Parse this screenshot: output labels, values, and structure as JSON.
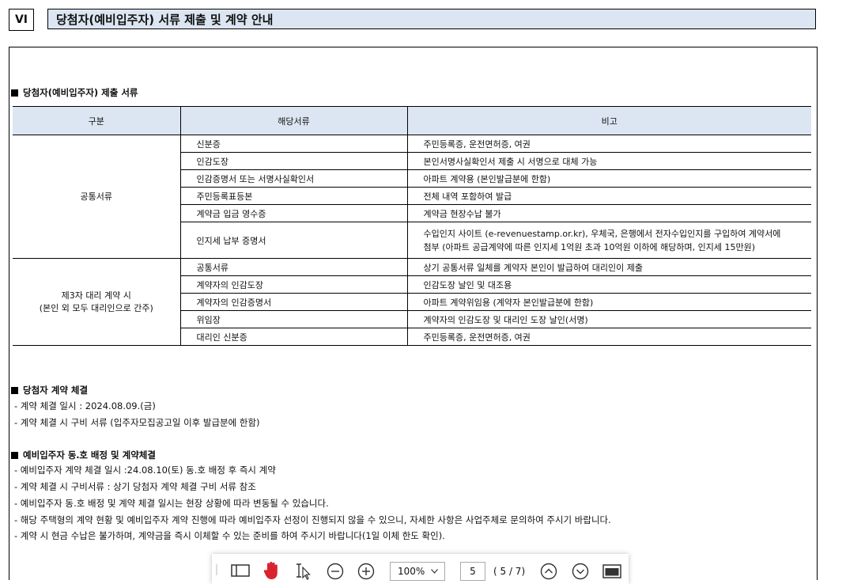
{
  "section": {
    "number": "VI",
    "title": "당첨자(예비입주자) 서류 제출 및 계약 안내"
  },
  "docs_section": {
    "heading": "당첨자(예비입주자) 제출 서류",
    "columns": [
      "구분",
      "해당서류",
      "비고"
    ],
    "groups": [
      {
        "category": "공통서류",
        "rows": [
          {
            "doc": "신분증",
            "note": "주민등록증, 운전면허증, 여권"
          },
          {
            "doc": "인감도장",
            "note": "본인서명사실확인서 제출 시 서명으로 대체 가능"
          },
          {
            "doc": "인감증명서 또는 서명사실확인서",
            "note": "아파트 계약용 (본인발급분에 한함)"
          },
          {
            "doc": "주민등록표등본",
            "note": "전체 내역 포함하여 발급"
          },
          {
            "doc": "계약금 입금 영수증",
            "note": "계약금 현장수납 불가"
          },
          {
            "doc": "인지세 납부 증명서",
            "note_line1": "수입인지 사이트 (e-revenuestamp.or.kr), 우체국, 은행에서 전자수입인지를 구입하여 계약서에",
            "note_line2": "첨부 (아파트 공급계약에 따른 인지세 1억원 초과 10억원 이하에 해당하며, 인지세 15만원)"
          }
        ]
      },
      {
        "category_line1": "제3자 대리 계약 시",
        "category_line2": "(본인 외 모두 대리인으로 간주)",
        "rows": [
          {
            "doc": "공통서류",
            "note": "상기 공통서류 일체를 계약자 본인이 발급하여 대리인이 제출"
          },
          {
            "doc": "계약자의 인감도장",
            "note": "인감도장 날인 및 대조용"
          },
          {
            "doc": "계약자의 인감증명서",
            "note": "아파트 계약위임용 (계약자 본인발급분에 한함)"
          },
          {
            "doc": "위임장",
            "note": "계약자의 인감도장 및 대리인 도장 날인(서명)"
          },
          {
            "doc": "대리인 신분증",
            "note": "주민등록증, 운전면허증, 여권"
          }
        ]
      }
    ]
  },
  "contract_section": {
    "heading": "당첨자 계약 체결",
    "lines": [
      "- 계약 체결 일시 : 2024.08.09.(금)",
      "- 계약 체결 시 구비 서류 (입주자모집공고일 이후 발급분에 한함)"
    ]
  },
  "reserve_section": {
    "heading": "예비입주자 동․호 배정 및 계약체결",
    "lines": [
      "- 예비입주자 계약 체결 일시 :24.08.10(토) 동․호 배정 후 즉시 계약",
      "- 계약 체결 시 구비서류 : 상기 당첨자 계약 체결 구비 서류 참조",
      "- 예비입주자 동․호 배정 및 계약 체결 일시는 현장 상황에 따라 변동될 수 있습니다.",
      "- 해당 주택형의 계약 현황 및 예비입주자 계약 진행에 따라 예비입주자 선정이 진행되지 않을 수 있으니, 자세한 사항은 사업주체로 문의하여 주시기 바랍니다.",
      "- 계약 시 현금 수납은 불가하며, 계약금을 즉시 이체할 수 있는 준비를 하여 주시기 바랍니다(1일 이체 한도 확인)."
    ]
  },
  "toolbar": {
    "zoom": "100%",
    "page_input": "5",
    "page_status": "( 5 / 7)",
    "icons": [
      "sidebar-toggle-icon",
      "hand-tool-icon",
      "text-select-icon",
      "zoom-out-icon",
      "zoom-in-icon",
      "previous-page-icon",
      "next-page-icon",
      "view-mode-icon"
    ],
    "hand_color": "#d9232e"
  }
}
